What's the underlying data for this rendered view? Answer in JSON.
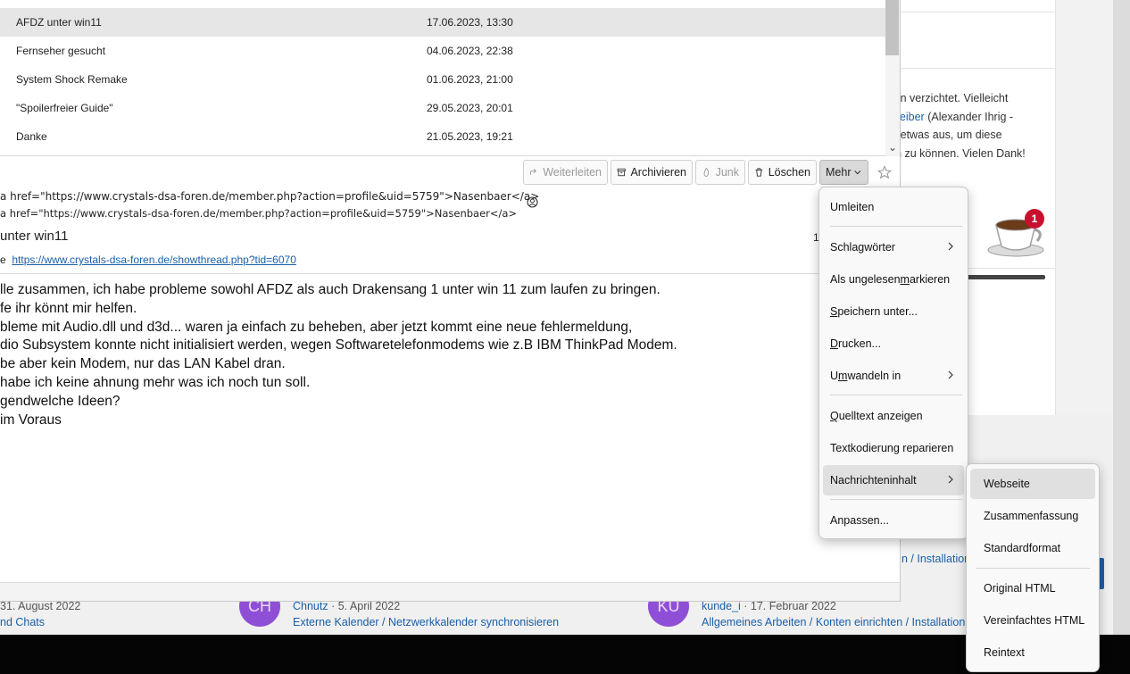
{
  "colors": {
    "accent": "#1a5fa8",
    "selection": "#e6e6e6",
    "menu_highlight": "#e0e0e0",
    "badge": "#c8102e"
  },
  "message_list": [
    {
      "subject": "AFDZ unter win11",
      "date": "17.06.2023, 13:30",
      "selected": true
    },
    {
      "subject": "Fernseher gesucht",
      "date": "04.06.2023, 22:38"
    },
    {
      "subject": "System Shock Remake",
      "date": "01.06.2023, 21:00"
    },
    {
      "subject": "\"Spoilerfreier Guide\"",
      "date": "29.05.2023, 20:01"
    },
    {
      "subject": "Danke",
      "date": "21.05.2023, 19:21"
    }
  ],
  "toolbar": {
    "forward": "Weiterleiten",
    "archive": "Archivieren",
    "junk": "Junk",
    "delete": "Löschen",
    "more": "Mehr"
  },
  "header": {
    "from": "a href=\"https://www.crystals-dsa-foren.de/member.php?action=profile&uid=5759\">Nasenbaer</a>",
    "to": "a href=\"https://www.crystals-dsa-foren.de/member.php?action=profile&uid=5759\">Nasenbaer</a>",
    "subject": "unter win11",
    "subject_right": "1",
    "website_prefix": "e",
    "website_url": "https://www.crystals-dsa-foren.de/showthread.php?tid=6070"
  },
  "body_lines": [
    "lle zusammen, ich habe probleme sowohl AFDZ als auch Drakensang 1 unter win 11 zum laufen zu bringen.",
    "fe ihr könnt mir helfen.",
    "bleme mit Audio.dll und d3d... waren ja einfach zu beheben, aber jetzt kommt eine neue fehlermeldung,",
    "dio Subsystem konnte nicht initialisiert werden, wegen Softwaretelefonmodems wie z.B IBM ThinkPad Modem.",
    "be aber kein Modem, nur das LAN Kabel dran.",
    "habe ich keine ahnung mehr was ich noch tun soll.",
    "gendwelche Ideen?",
    "im Voraus"
  ],
  "main_menu": {
    "umleiten": "Umleiten",
    "schlagwoerter": "Schlagwörter",
    "ungelesen_a": "Als ungelesen ",
    "ungelesen_u": "m",
    "ungelesen_b": "arkieren",
    "speichern_u": "S",
    "speichern_b": "peichern unter...",
    "drucken_u": "D",
    "drucken_b": "rucken...",
    "umwandeln_a": "U",
    "umwandeln_u": "m",
    "umwandeln_b": "wandeln in",
    "quelltext_u": "Q",
    "quelltext_b": "uelltext anzeigen",
    "textkodierung": "Textkodierung reparieren",
    "nachrichteninhalt": "Nachrichteninhalt",
    "anpassen": "Anpassen..."
  },
  "sub_menu": {
    "webseite": "Webseite",
    "zusammenfassung": "Zusammenfassung",
    "standardformat": "Standardformat",
    "original_html": "Original HTML",
    "vereinfachtes_html": "Vereinfachtes HTML",
    "reintext": "Reintext"
  },
  "background": {
    "sidebar_lines": [
      {
        "text": "eigen verzichtet. Vielleicht"
      },
      {
        "link": "Betreiber",
        "text": " (Alexander Ihrig -"
      },
      {
        "text": "sen etwas aus, um diese"
      },
      {
        "text": "eren zu können. Vielen Dank!"
      }
    ],
    "notification_count": "1",
    "install_fragment": "n / Installation",
    "threads": [
      {
        "avatar": "",
        "author": "",
        "date": "31. August 2022",
        "path": "nd Chats"
      },
      {
        "avatar": "CH",
        "author": "Chnutz",
        "date": "5. April 2022",
        "path": "Externe Kalender / Netzwerkkalender synchronisieren"
      },
      {
        "avatar": "KU",
        "author": "kunde_i",
        "date": "17. Februar 2022",
        "path": "Allgemeines Arbeiten / Konten einrichten / Installation"
      }
    ]
  }
}
